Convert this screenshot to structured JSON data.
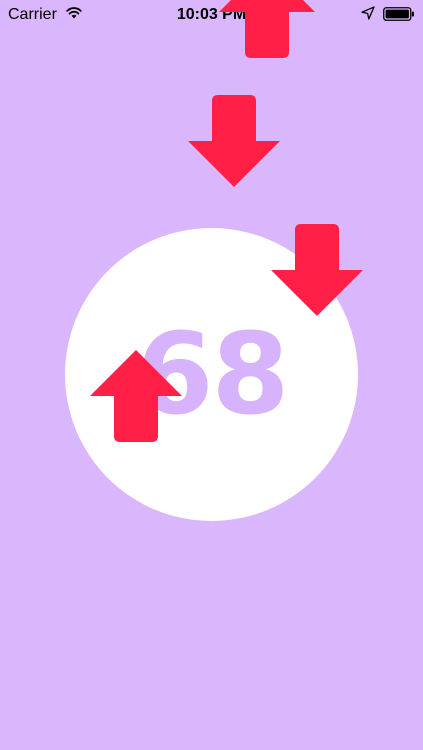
{
  "status_bar": {
    "carrier": "Carrier",
    "time": "10:03 PM"
  },
  "game": {
    "score": "68",
    "colors": {
      "background": "#dab6fc",
      "circle": "#ffffff",
      "score_text": "#d6b3fc",
      "arrow": "#ff1f47"
    },
    "arrows": [
      {
        "id": "arrow-top-partial",
        "direction": "up"
      },
      {
        "id": "arrow-upper-center",
        "direction": "down"
      },
      {
        "id": "arrow-right",
        "direction": "down"
      },
      {
        "id": "arrow-left",
        "direction": "up"
      }
    ]
  }
}
